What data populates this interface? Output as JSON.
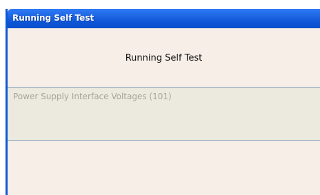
{
  "window": {
    "title": "Running Self Test"
  },
  "main": {
    "heading": "Running Self Test",
    "current_test": "Power Supply Interface Voltages (101)"
  }
}
